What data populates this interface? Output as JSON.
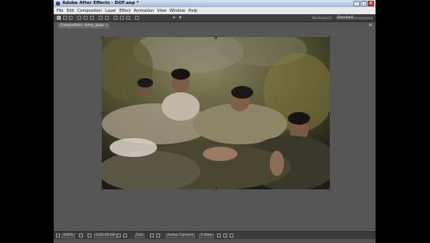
{
  "titlebar": {
    "title": "Adobe After Effects - DOF.aep *"
  },
  "window_buttons": {
    "minimize": "–",
    "maximize": "□",
    "close": "×"
  },
  "menu": [
    "File",
    "Edit",
    "Composition",
    "Layer",
    "Effect",
    "Animation",
    "View",
    "Window",
    "Help"
  ],
  "workspace": {
    "label": "Workspace:",
    "value": "Standard",
    "arrow": "»"
  },
  "composition_tab": {
    "label": "Composition: army_guys",
    "close": "×",
    "panel_menu": "≡"
  },
  "status_bar": {
    "zoom": "100%",
    "timecode": "0:00:00:00",
    "resolution": "Full",
    "view": "Active Camera",
    "views": "1 View"
  },
  "colors": {
    "app_bg": "#535353",
    "viewer_bg": "#565656",
    "titlebar": "#b8cbe6",
    "close": "#c9493c"
  },
  "icons": [
    "after-effects-app-icon",
    "selection-tool-icon",
    "hand-tool-icon",
    "zoom-tool-icon",
    "rotation-tool-icon",
    "camera-tool-icon",
    "pan-behind-tool-icon",
    "pen-tool-icon",
    "text-tool-icon",
    "brush-tool-icon",
    "clone-stamp-tool-icon",
    "eraser-tool-icon",
    "puppet-tool-icon",
    "camera-snapshot-icon",
    "show-channel-icon",
    "region-of-interest-icon",
    "transparency-grid-icon",
    "toggle-mask-icon"
  ]
}
